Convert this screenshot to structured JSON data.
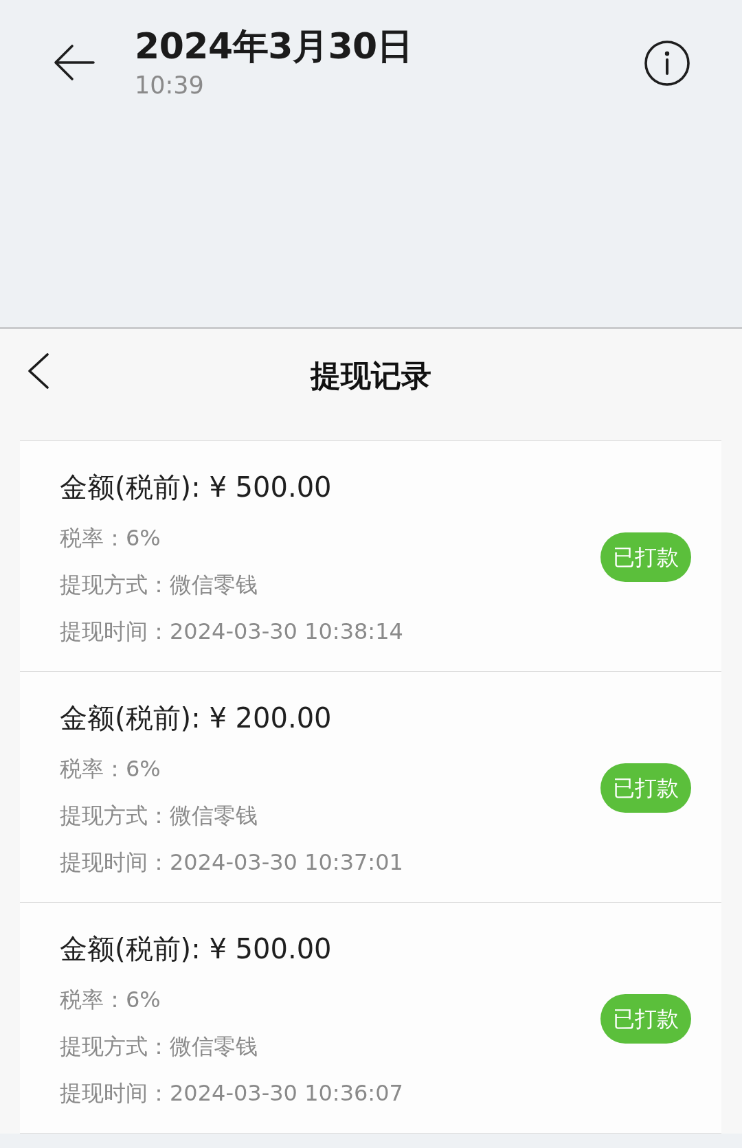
{
  "viewer_header": {
    "date": "2024年3月30日",
    "time": "10:39"
  },
  "screen": {
    "title": "提现记录",
    "records": [
      {
        "amount": "金额(税前): ¥ 500.00",
        "fields": [
          {
            "label": "税率：",
            "value": "6%"
          },
          {
            "label": "提现方式：",
            "value": "微信零钱"
          },
          {
            "label": "提现时间：",
            "value": "2024-03-30 10:38:14"
          }
        ],
        "status": "已打款"
      },
      {
        "amount": "金额(税前): ¥ 200.00",
        "fields": [
          {
            "label": "税率：",
            "value": "6%"
          },
          {
            "label": "提现方式：",
            "value": "微信零钱"
          },
          {
            "label": "提现时间：",
            "value": "2024-03-30 10:37:01"
          }
        ],
        "status": "已打款"
      },
      {
        "amount": "金额(税前): ¥ 500.00",
        "fields": [
          {
            "label": "税率：",
            "value": "6%"
          },
          {
            "label": "提现方式：",
            "value": "微信零钱"
          },
          {
            "label": "提现时间：",
            "value": "2024-03-30 10:36:07"
          }
        ],
        "status": "已打款"
      }
    ]
  }
}
